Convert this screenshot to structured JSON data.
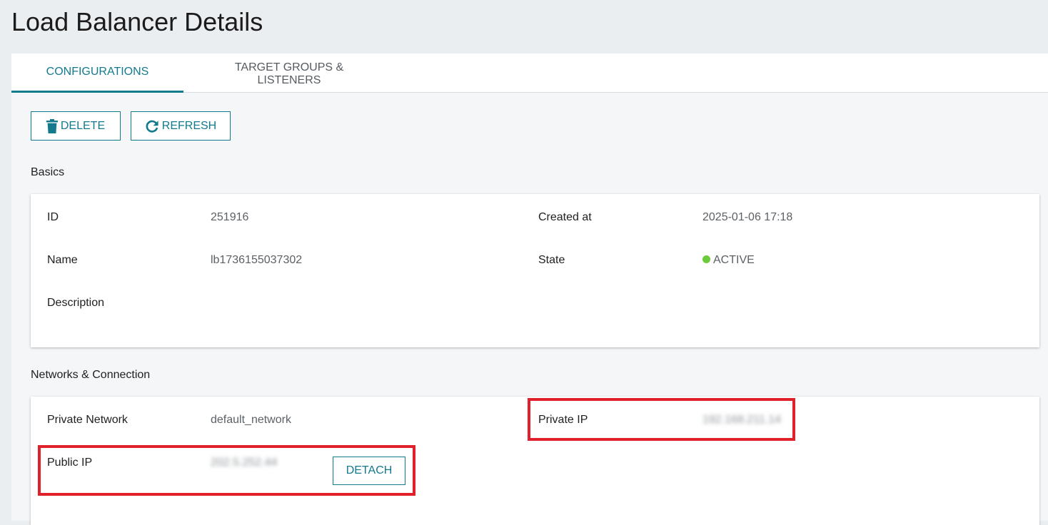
{
  "page": {
    "title": "Load Balancer Details"
  },
  "tabs": [
    {
      "label": "CONFIGURATIONS",
      "active": true
    },
    {
      "label": "TARGET GROUPS &\nLISTENERS",
      "active": false
    }
  ],
  "toolbar": {
    "delete_label": "DELETE",
    "refresh_label": "REFRESH"
  },
  "basics": {
    "section_title": "Basics",
    "id_label": "ID",
    "id_value": "251916",
    "created_label": "Created at",
    "created_value": "2025-01-06 17:18",
    "name_label": "Name",
    "name_value": "lb1736155037302",
    "state_label": "State",
    "state_value": "ACTIVE",
    "description_label": "Description"
  },
  "network": {
    "section_title": "Networks & Connection",
    "private_network_label": "Private Network",
    "private_network_value": "default_network",
    "private_ip_label": "Private IP",
    "private_ip_value": "192.168.211.14",
    "public_ip_label": "Public IP",
    "public_ip_value": "202.5.252.44",
    "detach_label": "DETACH"
  },
  "colors": {
    "accent": "#137a8e",
    "state_active": "#6ccb3a",
    "highlight": "#e0202a"
  },
  "icons": {
    "delete": "trash-icon",
    "refresh": "refresh-icon",
    "state": "status-dot-icon"
  }
}
